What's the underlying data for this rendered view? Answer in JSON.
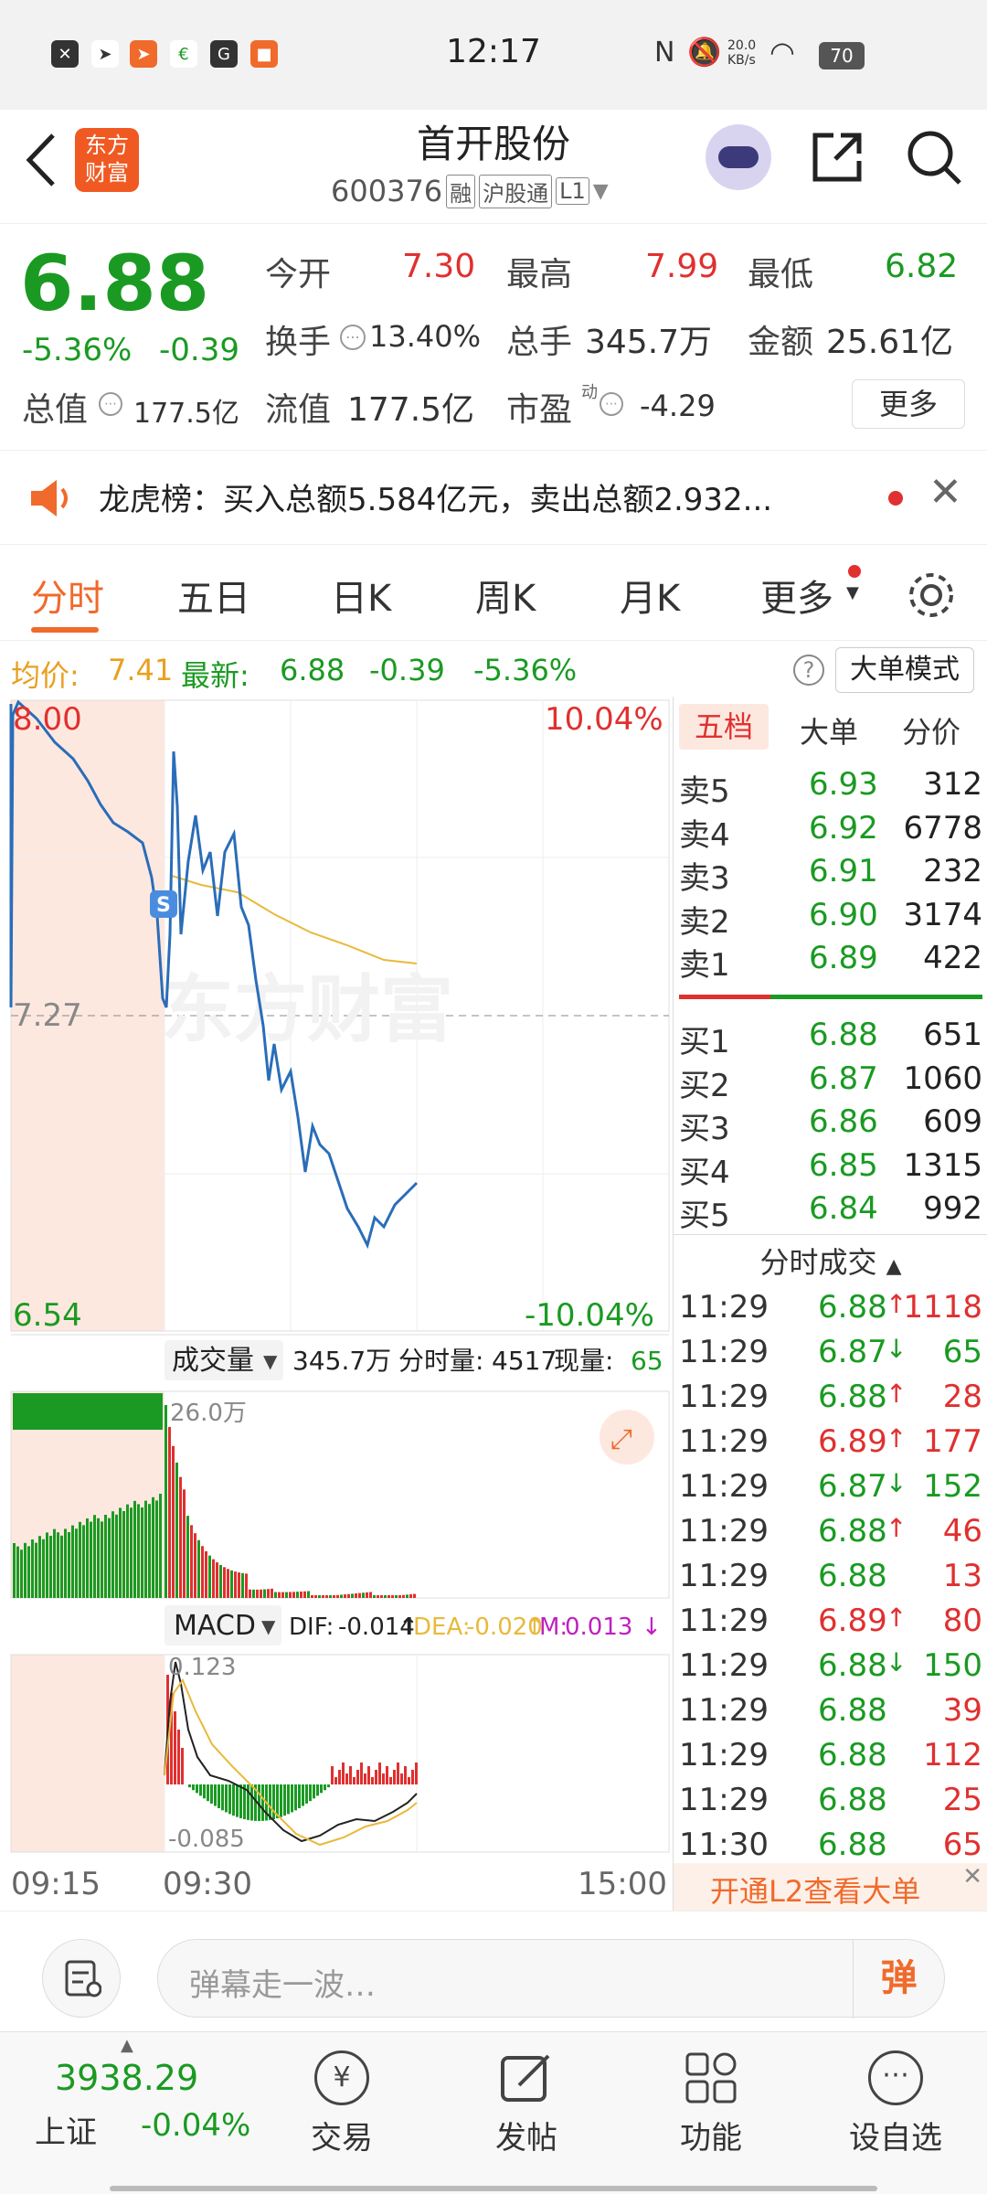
{
  "status_bar": {
    "time": "12:17",
    "net_speed": "20.0 KB/s",
    "battery": "70"
  },
  "header": {
    "title": "首开股份",
    "code": "600376",
    "tags": [
      "融",
      "沪股通",
      "L1"
    ],
    "logo_text": "东方财富"
  },
  "quote": {
    "price": "6.88",
    "change_pct": "-5.36%",
    "change": "-0.39",
    "open_label": "今开",
    "open": "7.30",
    "high_label": "最高",
    "high": "7.99",
    "low_label": "最低",
    "low": "6.82",
    "turnover_label": "换手",
    "turnover": "13.40%",
    "volume_label": "总手",
    "volume": "345.7万",
    "amount_label": "金额",
    "amount": "25.61亿",
    "mktcap_label": "总值",
    "mktcap": "177.5亿",
    "float_label": "流值",
    "float": "177.5亿",
    "pe_label": "市盈",
    "pe_sup": "动",
    "pe": "-4.29",
    "more_button": "更多"
  },
  "notice": {
    "text": "龙虎榜：买入总额5.584亿元，卖出总额2.932..."
  },
  "tabs": [
    "分时",
    "五日",
    "日K",
    "周K",
    "月K",
    "更多"
  ],
  "active_tab": "分时",
  "avg_bar": {
    "avg_label": "均价:",
    "avg": "7.41",
    "latest_label": "最新:",
    "latest": "6.88",
    "change": "-0.39",
    "change_pct": "-5.36%",
    "mode_button": "大单模式"
  },
  "chart": {
    "y_high": "8.00",
    "y_mid": "7.27",
    "y_low": "6.54",
    "pct_high": "10.04%",
    "pct_low": "-10.04%",
    "watermark": "东方财富",
    "vol_selector": "成交量",
    "vol_total": "345.7万",
    "vol_min_label": "分时量:",
    "vol_min": "4517",
    "vol_now_label": "现量:",
    "vol_now": "65",
    "vol_max": "26.0万",
    "macd_selector": "MACD",
    "dif_label": "DIF:",
    "dif": "-0.014",
    "dea_label": "DEA:",
    "dea": "-0.020",
    "m_label": "M:",
    "m": "0.013",
    "macd_high": "0.123",
    "macd_low": "-0.085",
    "time_start": "09:15",
    "time_open": "09:30",
    "time_end": "15:00",
    "colors": {
      "up": "#e0302f",
      "down": "#1a9a22",
      "price_line": "#2a6db8",
      "avg_line": "#e8b93b"
    }
  },
  "orderbook": {
    "tabs": [
      "五档",
      "大单",
      "分价"
    ],
    "asks": [
      {
        "label": "卖5",
        "price": "6.93",
        "qty": "312"
      },
      {
        "label": "卖4",
        "price": "6.92",
        "qty": "6778"
      },
      {
        "label": "卖3",
        "price": "6.91",
        "qty": "232"
      },
      {
        "label": "卖2",
        "price": "6.90",
        "qty": "3174"
      },
      {
        "label": "卖1",
        "price": "6.89",
        "qty": "422"
      }
    ],
    "bids": [
      {
        "label": "买1",
        "price": "6.88",
        "qty": "651"
      },
      {
        "label": "买2",
        "price": "6.87",
        "qty": "1060"
      },
      {
        "label": "买3",
        "price": "6.86",
        "qty": "609"
      },
      {
        "label": "买4",
        "price": "6.85",
        "qty": "1315"
      },
      {
        "label": "买5",
        "price": "6.84",
        "qty": "992"
      }
    ],
    "trades_title": "分时成交",
    "trades": [
      {
        "time": "11:29",
        "price": "6.88",
        "dir": "↑",
        "qty": "1118"
      },
      {
        "time": "11:29",
        "price": "6.87",
        "dir": "↓",
        "qty": "65"
      },
      {
        "time": "11:29",
        "price": "6.88",
        "dir": "↑",
        "qty": "28"
      },
      {
        "time": "11:29",
        "price": "6.89",
        "dir": "↑",
        "qty": "177"
      },
      {
        "time": "11:29",
        "price": "6.87",
        "dir": "↓",
        "qty": "152"
      },
      {
        "time": "11:29",
        "price": "6.88",
        "dir": "↑",
        "qty": "46"
      },
      {
        "time": "11:29",
        "price": "6.88",
        "dir": "",
        "qty": "13"
      },
      {
        "time": "11:29",
        "price": "6.89",
        "dir": "↑",
        "qty": "80"
      },
      {
        "time": "11:29",
        "price": "6.88",
        "dir": "↓",
        "qty": "150"
      },
      {
        "time": "11:29",
        "price": "6.88",
        "dir": "",
        "qty": "39"
      },
      {
        "time": "11:29",
        "price": "6.88",
        "dir": "",
        "qty": "112"
      },
      {
        "time": "11:29",
        "price": "6.88",
        "dir": "",
        "qty": "25"
      },
      {
        "time": "11:30",
        "price": "6.88",
        "dir": "",
        "qty": "65"
      }
    ],
    "l2_banner": "开通L2查看大单"
  },
  "danmu": {
    "placeholder": "弹幕走一波…",
    "send_label": "弹"
  },
  "bottom_nav": {
    "index_value": "3938.29",
    "index_name": "上证",
    "index_change": "-0.04%",
    "items": [
      "交易",
      "发帖",
      "功能",
      "设自选"
    ]
  }
}
